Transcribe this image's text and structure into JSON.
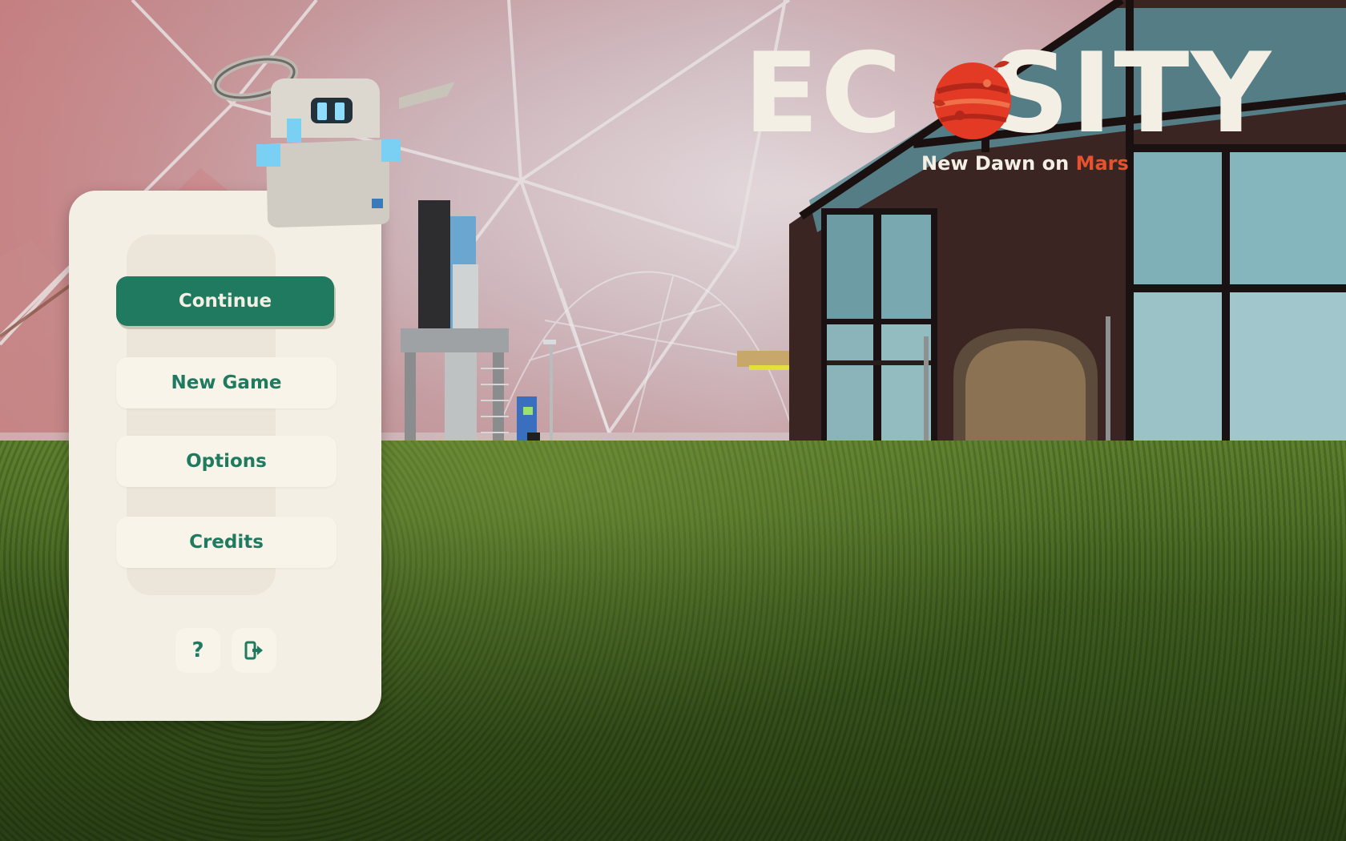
{
  "logo": {
    "title_part1": "EC",
    "title_part2": "SITY",
    "subtitle_prefix": "New Dawn on ",
    "subtitle_accent": "Mars"
  },
  "menu": {
    "continue_label": "Continue",
    "new_game_label": "New Game",
    "options_label": "Options",
    "credits_label": "Credits",
    "help_label": "?",
    "help_icon": "question-icon",
    "exit_icon": "exit-door-icon"
  },
  "colors": {
    "primary_green": "#1f7a60",
    "panel_cream": "#f4efe4",
    "accent_red": "#e8502e"
  }
}
